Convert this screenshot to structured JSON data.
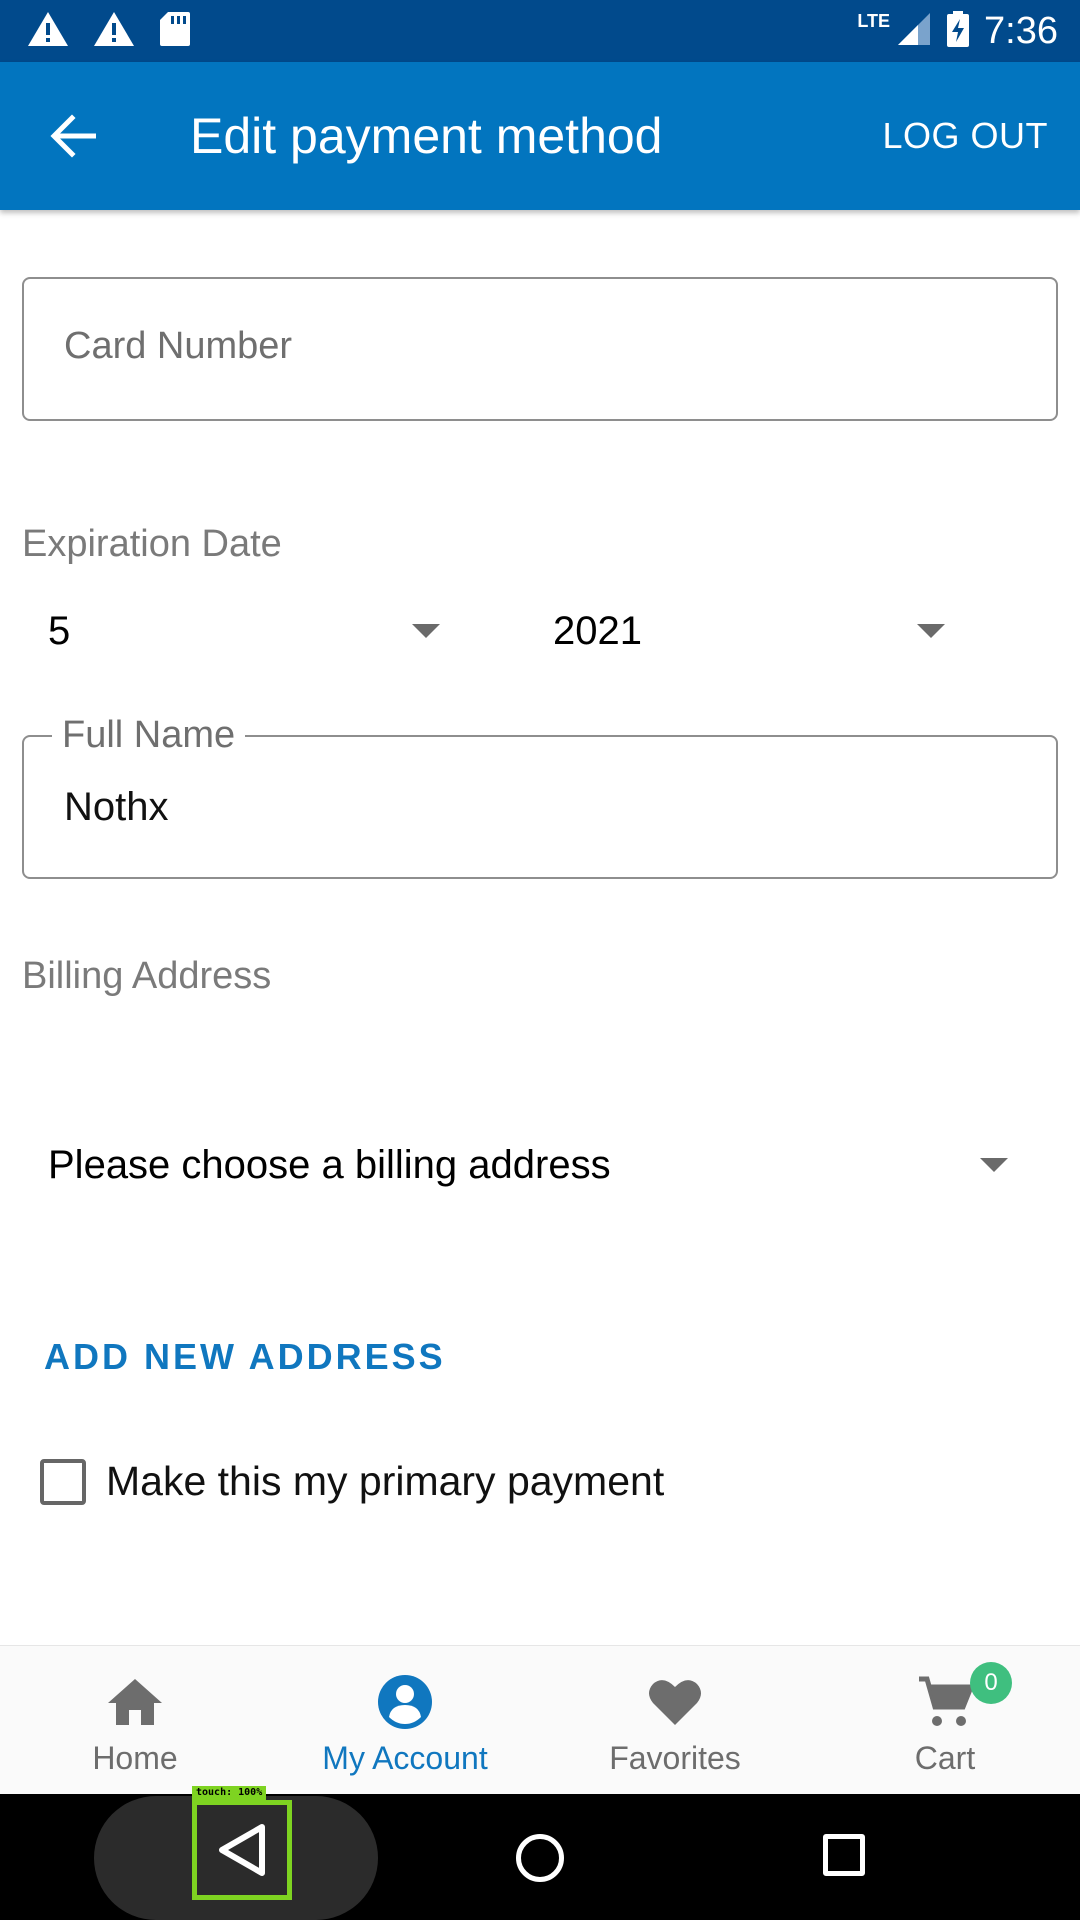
{
  "status_bar": {
    "time": "7:36",
    "network_label": "LTE",
    "icons": [
      "warning-icon",
      "warning-icon",
      "sd-card-icon",
      "signal-icon",
      "battery-charging-icon"
    ]
  },
  "app_bar": {
    "title": "Edit payment method",
    "logout_label": "LOG OUT",
    "back_icon": "arrow-back-icon"
  },
  "form": {
    "card_number_placeholder": "Card Number",
    "expiration_label": "Expiration Date",
    "expiration_month": "5",
    "expiration_year": "2021",
    "full_name_label": "Full Name",
    "full_name_value": "Nothx",
    "billing_label": "Billing Address",
    "billing_select_value": "Please choose a billing address",
    "add_address_label": "ADD NEW ADDRESS",
    "primary_checkbox_label": "Make this my primary payment",
    "primary_checked": false
  },
  "bottom_nav": {
    "items": [
      {
        "label": "Home",
        "icon": "home-icon",
        "active": false
      },
      {
        "label": "My Account",
        "icon": "account-icon",
        "active": true
      },
      {
        "label": "Favorites",
        "icon": "heart-icon",
        "active": false
      },
      {
        "label": "Cart",
        "icon": "cart-icon",
        "active": false
      }
    ],
    "cart_count": "0"
  },
  "system_nav": {
    "touch_indicator": "touch: 100%"
  },
  "colors": {
    "status_bar": "#014a8c",
    "app_bar": "#0275bf",
    "accent": "#1077bf",
    "badge": "#3fbf7f"
  }
}
